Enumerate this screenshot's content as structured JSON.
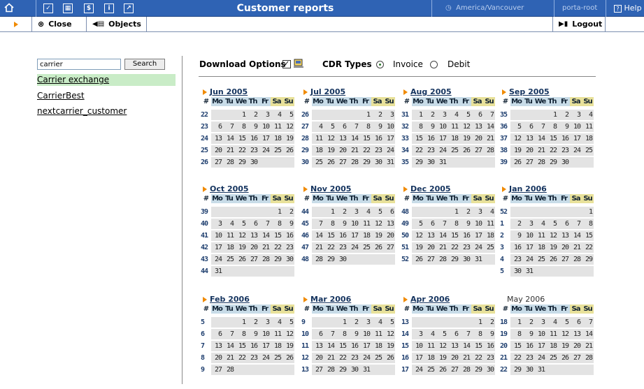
{
  "window_title": "Customer reports",
  "timezone": "America/Vancouver",
  "user": "porta-root",
  "help_label": "Help",
  "toolbar": {
    "close_label": "Close",
    "objects_label": "Objects",
    "logout_label": "Logout"
  },
  "search": {
    "value": "carrier",
    "button_label": "Search"
  },
  "results": [
    "Carrier exchange",
    "CarrierBest",
    "nextcarrier_customer"
  ],
  "download_options_label": "Download Options",
  "cdr_types_label": "CDR Types",
  "cdr_types": [
    {
      "label": "Invoice",
      "selected": true
    },
    {
      "label": "Debit",
      "selected": false
    }
  ],
  "weekday_headers": [
    "#",
    "Mo",
    "Tu",
    "We",
    "Th",
    "Fr",
    "Sa",
    "Su"
  ],
  "calendars": [
    {
      "title": "Jun 2005",
      "link": true,
      "weeks": [
        {
          "w": "22",
          "d": [
            "",
            "",
            "1",
            "2",
            "3",
            "4",
            "5"
          ]
        },
        {
          "w": "23",
          "d": [
            "6",
            "7",
            "8",
            "9",
            "10",
            "11",
            "12"
          ]
        },
        {
          "w": "24",
          "d": [
            "13",
            "14",
            "15",
            "16",
            "17",
            "18",
            "19"
          ]
        },
        {
          "w": "25",
          "d": [
            "20",
            "21",
            "22",
            "23",
            "24",
            "25",
            "26"
          ]
        },
        {
          "w": "26",
          "d": [
            "27",
            "28",
            "29",
            "30",
            "",
            "",
            ""
          ]
        }
      ]
    },
    {
      "title": "Jul 2005",
      "link": true,
      "weeks": [
        {
          "w": "26",
          "d": [
            "",
            "",
            "",
            "",
            "1",
            "2",
            "3"
          ]
        },
        {
          "w": "27",
          "d": [
            "4",
            "5",
            "6",
            "7",
            "8",
            "9",
            "10"
          ]
        },
        {
          "w": "28",
          "d": [
            "11",
            "12",
            "13",
            "14",
            "15",
            "16",
            "17"
          ]
        },
        {
          "w": "29",
          "d": [
            "18",
            "19",
            "20",
            "21",
            "22",
            "23",
            "24"
          ]
        },
        {
          "w": "30",
          "d": [
            "25",
            "26",
            "27",
            "28",
            "29",
            "30",
            "31"
          ]
        }
      ]
    },
    {
      "title": "Aug 2005",
      "link": true,
      "weeks": [
        {
          "w": "31",
          "d": [
            "1",
            "2",
            "3",
            "4",
            "5",
            "6",
            "7"
          ]
        },
        {
          "w": "32",
          "d": [
            "8",
            "9",
            "10",
            "11",
            "12",
            "13",
            "14"
          ]
        },
        {
          "w": "33",
          "d": [
            "15",
            "16",
            "17",
            "18",
            "19",
            "20",
            "21"
          ]
        },
        {
          "w": "34",
          "d": [
            "22",
            "23",
            "24",
            "25",
            "26",
            "27",
            "28"
          ]
        },
        {
          "w": "35",
          "d": [
            "29",
            "30",
            "31",
            "",
            "",
            "",
            ""
          ]
        }
      ]
    },
    {
      "title": "Sep 2005",
      "link": true,
      "weeks": [
        {
          "w": "35",
          "d": [
            "",
            "",
            "",
            "1",
            "2",
            "3",
            "4"
          ]
        },
        {
          "w": "36",
          "d": [
            "5",
            "6",
            "7",
            "8",
            "9",
            "10",
            "11"
          ]
        },
        {
          "w": "37",
          "d": [
            "12",
            "13",
            "14",
            "15",
            "16",
            "17",
            "18"
          ]
        },
        {
          "w": "38",
          "d": [
            "19",
            "20",
            "21",
            "22",
            "23",
            "24",
            "25"
          ]
        },
        {
          "w": "39",
          "d": [
            "26",
            "27",
            "28",
            "29",
            "30",
            "",
            ""
          ]
        }
      ]
    },
    {
      "title": "Oct 2005",
      "link": true,
      "weeks": [
        {
          "w": "39",
          "d": [
            "",
            "",
            "",
            "",
            "",
            "1",
            "2"
          ]
        },
        {
          "w": "40",
          "d": [
            "3",
            "4",
            "5",
            "6",
            "7",
            "8",
            "9"
          ]
        },
        {
          "w": "41",
          "d": [
            "10",
            "11",
            "12",
            "13",
            "14",
            "15",
            "16"
          ]
        },
        {
          "w": "42",
          "d": [
            "17",
            "18",
            "19",
            "20",
            "21",
            "22",
            "23"
          ]
        },
        {
          "w": "43",
          "d": [
            "24",
            "25",
            "26",
            "27",
            "28",
            "29",
            "30"
          ]
        },
        {
          "w": "44",
          "d": [
            "31",
            "",
            "",
            "",
            "",
            "",
            ""
          ]
        }
      ]
    },
    {
      "title": "Nov 2005",
      "link": true,
      "weeks": [
        {
          "w": "44",
          "d": [
            "",
            "1",
            "2",
            "3",
            "4",
            "5",
            "6"
          ]
        },
        {
          "w": "45",
          "d": [
            "7",
            "8",
            "9",
            "10",
            "11",
            "12",
            "13"
          ]
        },
        {
          "w": "46",
          "d": [
            "14",
            "15",
            "16",
            "17",
            "18",
            "19",
            "20"
          ]
        },
        {
          "w": "47",
          "d": [
            "21",
            "22",
            "23",
            "24",
            "25",
            "26",
            "27"
          ]
        },
        {
          "w": "48",
          "d": [
            "28",
            "29",
            "30",
            "",
            "",
            "",
            ""
          ]
        }
      ]
    },
    {
      "title": "Dec 2005",
      "link": true,
      "weeks": [
        {
          "w": "48",
          "d": [
            "",
            "",
            "",
            "1",
            "2",
            "3",
            "4"
          ]
        },
        {
          "w": "49",
          "d": [
            "5",
            "6",
            "7",
            "8",
            "9",
            "10",
            "11"
          ]
        },
        {
          "w": "50",
          "d": [
            "12",
            "13",
            "14",
            "15",
            "16",
            "17",
            "18"
          ]
        },
        {
          "w": "51",
          "d": [
            "19",
            "20",
            "21",
            "22",
            "23",
            "24",
            "25"
          ]
        },
        {
          "w": "52",
          "d": [
            "26",
            "27",
            "28",
            "29",
            "30",
            "31",
            ""
          ]
        }
      ]
    },
    {
      "title": "Jan 2006",
      "link": true,
      "weeks": [
        {
          "w": "52",
          "d": [
            "",
            "",
            "",
            "",
            "",
            "",
            "1"
          ]
        },
        {
          "w": "1",
          "d": [
            "2",
            "3",
            "4",
            "5",
            "6",
            "7",
            "8"
          ]
        },
        {
          "w": "2",
          "d": [
            "9",
            "10",
            "11",
            "12",
            "13",
            "14",
            "15"
          ]
        },
        {
          "w": "3",
          "d": [
            "16",
            "17",
            "18",
            "19",
            "20",
            "21",
            "22"
          ]
        },
        {
          "w": "4",
          "d": [
            "23",
            "24",
            "25",
            "26",
            "27",
            "28",
            "29"
          ]
        },
        {
          "w": "5",
          "d": [
            "30",
            "31",
            "",
            "",
            "",
            "",
            ""
          ]
        }
      ]
    },
    {
      "title": "Feb 2006",
      "link": true,
      "weeks": [
        {
          "w": "5",
          "d": [
            "",
            "",
            "1",
            "2",
            "3",
            "4",
            "5"
          ]
        },
        {
          "w": "6",
          "d": [
            "6",
            "7",
            "8",
            "9",
            "10",
            "11",
            "12"
          ]
        },
        {
          "w": "7",
          "d": [
            "13",
            "14",
            "15",
            "16",
            "17",
            "18",
            "19"
          ]
        },
        {
          "w": "8",
          "d": [
            "20",
            "21",
            "22",
            "23",
            "24",
            "25",
            "26"
          ]
        },
        {
          "w": "9",
          "d": [
            "27",
            "28",
            "",
            "",
            "",
            "",
            ""
          ]
        }
      ]
    },
    {
      "title": "Mar 2006",
      "link": true,
      "weeks": [
        {
          "w": "9",
          "d": [
            "",
            "",
            "1",
            "2",
            "3",
            "4",
            "5"
          ]
        },
        {
          "w": "10",
          "d": [
            "6",
            "7",
            "8",
            "9",
            "10",
            "11",
            "12"
          ]
        },
        {
          "w": "11",
          "d": [
            "13",
            "14",
            "15",
            "16",
            "17",
            "18",
            "19"
          ]
        },
        {
          "w": "12",
          "d": [
            "20",
            "21",
            "22",
            "23",
            "24",
            "25",
            "26"
          ]
        },
        {
          "w": "13",
          "d": [
            "27",
            "28",
            "29",
            "30",
            "31",
            "",
            ""
          ]
        }
      ]
    },
    {
      "title": "Apr 2006",
      "link": true,
      "weeks": [
        {
          "w": "13",
          "d": [
            "",
            "",
            "",
            "",
            "",
            "1",
            "2"
          ]
        },
        {
          "w": "14",
          "d": [
            "3",
            "4",
            "5",
            "6",
            "7",
            "8",
            "9"
          ]
        },
        {
          "w": "15",
          "d": [
            "10",
            "11",
            "12",
            "13",
            "14",
            "15",
            "16"
          ]
        },
        {
          "w": "16",
          "d": [
            "17",
            "18",
            "19",
            "20",
            "21",
            "22",
            "23"
          ]
        },
        {
          "w": "17",
          "d": [
            "24",
            "25",
            "26",
            "27",
            "28",
            "29",
            "30"
          ]
        }
      ]
    },
    {
      "title": "May 2006",
      "link": false,
      "weeks": [
        {
          "w": "18",
          "d": [
            "1",
            "2",
            "3",
            "4",
            "5",
            "6",
            "7"
          ]
        },
        {
          "w": "19",
          "d": [
            "8",
            "9",
            "10",
            "11",
            "12",
            "13",
            "14"
          ]
        },
        {
          "w": "20",
          "d": [
            "15",
            "16",
            "17",
            "18",
            "19",
            "20",
            "21"
          ]
        },
        {
          "w": "21",
          "d": [
            "22",
            "23",
            "24",
            "25",
            "26",
            "27",
            "28"
          ]
        },
        {
          "w": "22",
          "d": [
            "29",
            "30",
            "31",
            "",
            "",
            "",
            ""
          ]
        }
      ]
    }
  ]
}
